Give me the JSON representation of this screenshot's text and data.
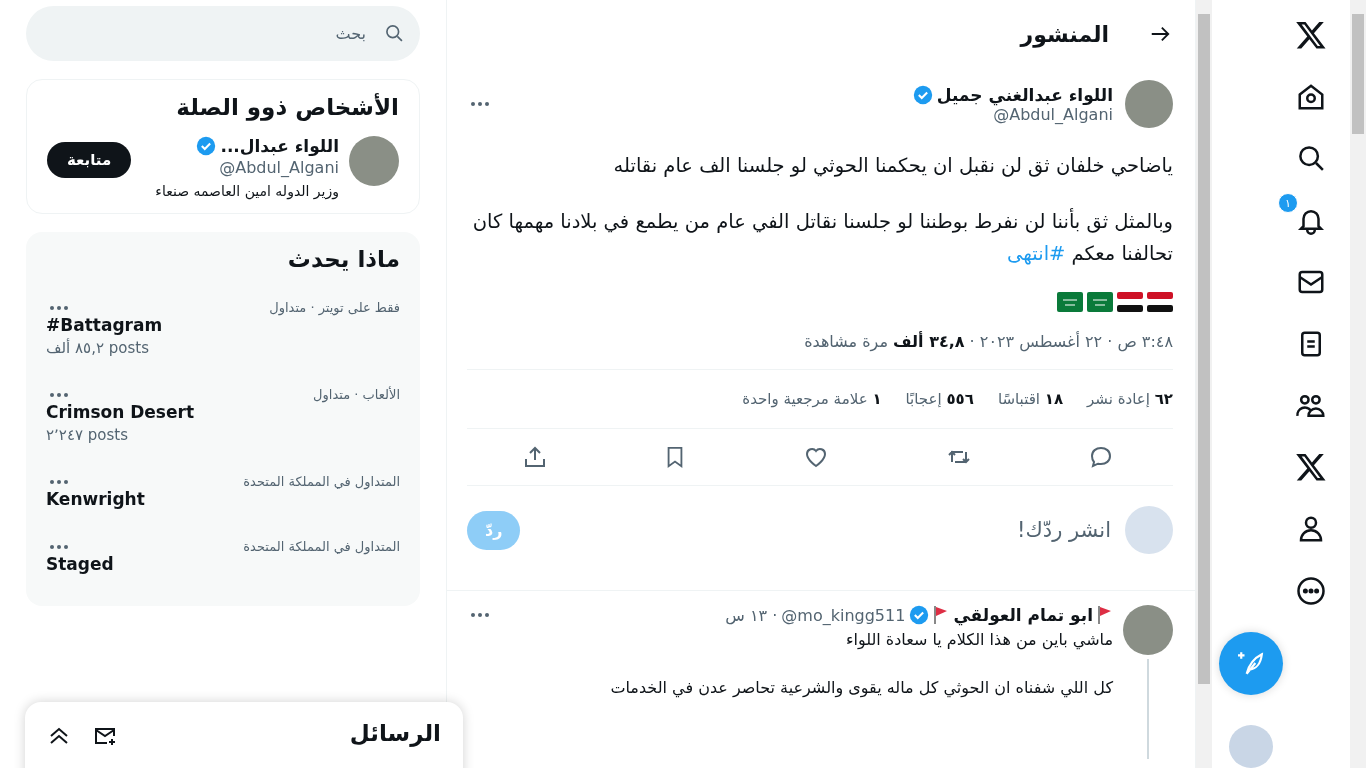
{
  "nav": {
    "items": [
      {
        "kind": "x"
      },
      {
        "kind": "home"
      },
      {
        "kind": "search"
      },
      {
        "kind": "bell",
        "badge": "١"
      },
      {
        "kind": "mail"
      },
      {
        "kind": "list"
      },
      {
        "kind": "people"
      },
      {
        "kind": "x"
      },
      {
        "kind": "person"
      },
      {
        "kind": "more"
      }
    ]
  },
  "header": {
    "title": "المنشور"
  },
  "post": {
    "author": "اللواء عبدالغني جميل",
    "verified": true,
    "handle": "@Abdul_Algani",
    "paragraphs": [
      "ياضاحي خلفان ثق لن نقبل ان يحكمنا الحوثي لو جلسنا الف عام نقاتله",
      "وبالمثل ثق بأننا لن نفرط بوطننا لو جلسنا نقاتل الفي عام من يطمع في بلادنا مهمها كان تحالفنا معكم"
    ],
    "hashtag": "#انتهى",
    "flags": [
      {
        "kind": "yemen"
      },
      {
        "kind": "yemen"
      },
      {
        "kind": "saudi"
      },
      {
        "kind": "saudi"
      }
    ],
    "meta": "٣:٤٨ ص · ٢٢ أغسطس ٢٠٢٣ · **٣٤,٨ ألف** مرة مشاهدة",
    "stats": [
      "**٦٢** إعادة نشر",
      "**١٨** اقتباسًا",
      "**٥٥٦** إعجابًا",
      "**١** علامة مرجعية واحدة"
    ],
    "actions": [
      {
        "kind": "reply"
      },
      {
        "kind": "repost"
      },
      {
        "kind": "like"
      },
      {
        "kind": "bookmark"
      },
      {
        "kind": "share"
      }
    ]
  },
  "composer": {
    "placeholder": "انشر ردّك!",
    "button": "ردّ",
    "disabled": true
  },
  "reply": {
    "author": "ابو تمام العولقي",
    "verified": true,
    "handle": "@mo_kingg511",
    "time": "· ١٣ س",
    "paragraphs": [
      "ماشي باين من هذا الكلام يا سعادة اللواء",
      "كل اللي شفناه ان الحوثي كل ماله يقوى والشرعية تحاصر عدن في الخدمات"
    ]
  },
  "search": {
    "placeholder": "بحث"
  },
  "relevant": {
    "title": "الأشخاص ذوو الصلة",
    "people": [
      {
        "name": "اللواء عبدال...",
        "verified": true,
        "handle": "@Abdul_Algani",
        "bio": "وزير الدوله امين العاصمه صنعاء",
        "button": "متابعة"
      }
    ]
  },
  "trends": {
    "title": "ماذا يحدث",
    "items": [
      {
        "context": "فقط على تويتر · متداول",
        "name": "#Battagram",
        "count": "٨٥,٢ ألف posts"
      },
      {
        "context": "الألعاب · متداول",
        "name": "Crimson Desert",
        "count": "٢٬٢٤٧ posts"
      },
      {
        "context": "المتداول في المملكة المتحدة",
        "name": "Kenwright"
      },
      {
        "context": "المتداول في المملكة المتحدة",
        "name": "Staged"
      }
    ]
  },
  "messages": {
    "title": "الرسائل"
  }
}
